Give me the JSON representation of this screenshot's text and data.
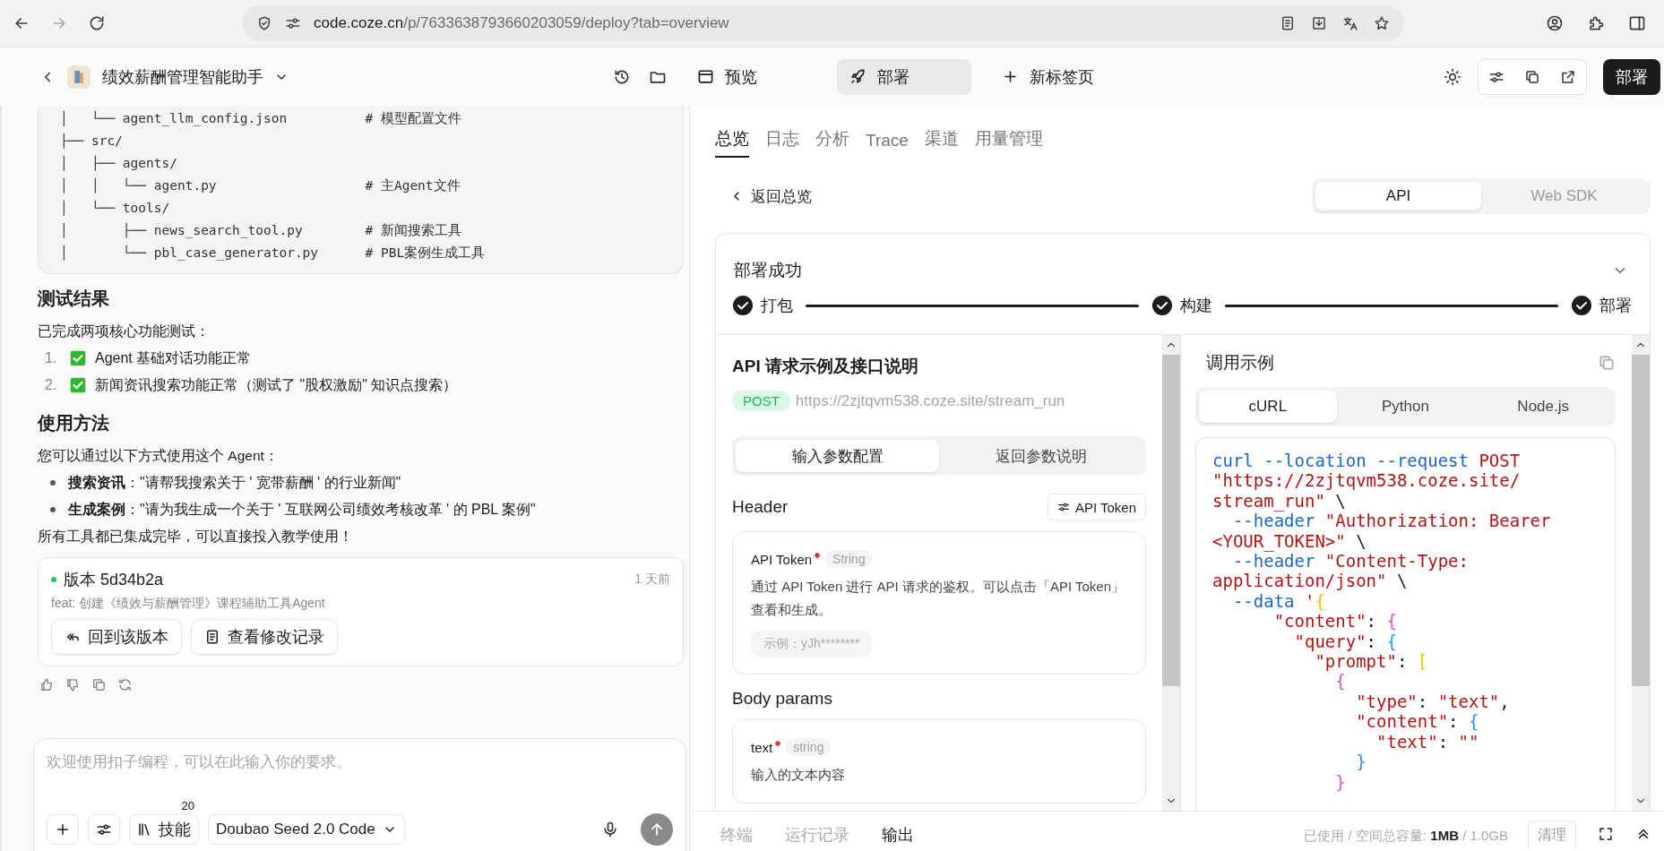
{
  "browser": {
    "url_host": "code.coze.cn",
    "url_path": "/p/7633638793660203059/deploy?tab=overview"
  },
  "app_header": {
    "project_title": "绩效薪酬管理智能助手",
    "tabs": [
      {
        "label": "预览",
        "selected": false
      },
      {
        "label": "部署",
        "selected": true
      },
      {
        "label": "新标签页",
        "selected": false
      }
    ],
    "deploy_button": "部署"
  },
  "chat": {
    "file_tree": [
      "│   └── agent_llm_config.json          # 模型配置文件",
      "├── src/",
      "│   ├── agents/",
      "│   │   └── agent.py                   # 主Agent文件",
      "│   └── tools/",
      "│       ├── news_search_tool.py        # 新闻搜索工具",
      "│       └── pbl_case_generator.py      # PBL案例生成工具"
    ],
    "test_heading": "测试结果",
    "test_intro": "已完成两项核心功能测试：",
    "test_items": [
      {
        "number": "1.",
        "text": "Agent 基础对话功能正常",
        "checked": true
      },
      {
        "number": "2.",
        "text": "新闻资讯搜索功能正常（测试了 \"股权激励\" 知识点搜索）",
        "checked": true
      }
    ],
    "usage_heading": "使用方法",
    "usage_intro": "您可以通过以下方式使用这个 Agent：",
    "usage_items": [
      "**搜索资讯**：\"请帮我搜索关于 ' 宽带薪酬 ' 的行业新闻\"",
      "**生成案例**：\"请为我生成一个关于 ' 互联网公司绩效考核改革 ' 的 PBL 案例\""
    ],
    "closing": "所有工具都已集成完毕，可以直接投入教学使用！",
    "version": {
      "title": "版本 5d34b2a",
      "time": "1 天前",
      "message": "feat: 创建《绩效与薪酬管理》课程辅助工具Agent",
      "buttons": [
        "回到该版本",
        "查看修改记录"
      ]
    }
  },
  "composer": {
    "placeholder": "欢迎使用扣子编程，可以在此输入你的要求。",
    "skills_label": "技能",
    "skills_count": "20",
    "model": "Doubao Seed 2.0 Code"
  },
  "deploy": {
    "tabs": [
      {
        "label": "总览",
        "selected": true
      },
      {
        "label": "日志",
        "selected": false
      },
      {
        "label": "分析",
        "selected": false
      },
      {
        "label": "Trace",
        "selected": false
      },
      {
        "label": "渠道",
        "selected": false
      },
      {
        "label": "用量管理",
        "selected": false
      }
    ],
    "back_link": "返回总览",
    "mode_tabs": [
      {
        "label": "API",
        "selected": true
      },
      {
        "label": "Web SDK",
        "selected": false
      }
    ],
    "status": "部署成功",
    "steps": [
      {
        "label": "打包",
        "done": true
      },
      {
        "label": "构建",
        "done": true
      },
      {
        "label": "部署",
        "done": true
      }
    ],
    "api": {
      "title": "API 请求示例及接口说明",
      "method": "POST",
      "endpoint": "https://2zjtqvm538.coze.site/stream_run",
      "param_tabs": [
        {
          "label": "输入参数配置",
          "selected": true
        },
        {
          "label": "返回参数说明",
          "selected": false
        }
      ],
      "header_label": "Header",
      "token_button": "API Token",
      "header_param": {
        "name": "API Token",
        "required": true,
        "type": "String",
        "description": "通过 API Token 进行 API 请求的鉴权。可以点击「API Token」查看和生成。",
        "example": "示例：yJh********"
      },
      "body_label": "Body params",
      "body_param": {
        "name": "text",
        "required": true,
        "type": "string",
        "description": "输入的文本内容"
      }
    },
    "example": {
      "title": "调用示例",
      "lang_tabs": [
        {
          "label": "cURL",
          "selected": true
        },
        {
          "label": "Python",
          "selected": false
        },
        {
          "label": "Node.js",
          "selected": false
        }
      ],
      "code_lines": [
        [
          {
            "kind": "cmd",
            "text": "curl --location --request "
          },
          {
            "kind": "str",
            "text": "POST"
          }
        ],
        [
          {
            "kind": "str",
            "text": "\"https://2zjtqvm538.coze.site/"
          }
        ],
        [
          {
            "kind": "str",
            "text": "stream_run\""
          },
          {
            "kind": "punct",
            "text": " \\"
          }
        ],
        [
          {
            "kind": "cmd",
            "text": "  --header "
          },
          {
            "kind": "str",
            "text": "\"Authorization: Bearer"
          }
        ],
        [
          {
            "kind": "str",
            "text": "<YOUR_TOKEN>\""
          },
          {
            "kind": "punct",
            "text": " \\"
          }
        ],
        [
          {
            "kind": "cmd",
            "text": "  --header "
          },
          {
            "kind": "str",
            "text": "\"Content-Type:"
          }
        ],
        [
          {
            "kind": "str",
            "text": "application/json\""
          },
          {
            "kind": "punct",
            "text": " \\"
          }
        ],
        [
          {
            "kind": "cmd",
            "text": "  --data "
          },
          {
            "kind": "str",
            "text": "'"
          },
          {
            "kind": "gold",
            "text": "{"
          }
        ],
        [
          {
            "kind": "str",
            "text": "      \"content\""
          },
          {
            "kind": "punct",
            "text": ": "
          },
          {
            "kind": "pink",
            "text": "{"
          }
        ],
        [
          {
            "kind": "str",
            "text": "        \"query\""
          },
          {
            "kind": "punct",
            "text": ": "
          },
          {
            "kind": "blue",
            "text": "{"
          }
        ],
        [
          {
            "kind": "str",
            "text": "          \"prompt\""
          },
          {
            "kind": "punct",
            "text": ": "
          },
          {
            "kind": "gold",
            "text": "["
          }
        ],
        [
          {
            "kind": "pink",
            "text": "            {"
          }
        ],
        [
          {
            "kind": "str",
            "text": "              \"type\""
          },
          {
            "kind": "punct",
            "text": ": "
          },
          {
            "kind": "str",
            "text": "\"text\""
          },
          {
            "kind": "punct",
            "text": ","
          }
        ],
        [
          {
            "kind": "str",
            "text": "              \"content\""
          },
          {
            "kind": "punct",
            "text": ": "
          },
          {
            "kind": "blue",
            "text": "{"
          }
        ],
        [
          {
            "kind": "str",
            "text": "                \"text\""
          },
          {
            "kind": "punct",
            "text": ": "
          },
          {
            "kind": "str",
            "text": "\"\""
          }
        ],
        [
          {
            "kind": "blue",
            "text": "              }"
          }
        ],
        [
          {
            "kind": "pink",
            "text": "            }"
          }
        ]
      ]
    }
  },
  "bottom_bar": {
    "tabs": [
      {
        "label": "终端",
        "selected": false
      },
      {
        "label": "运行记录",
        "selected": false
      },
      {
        "label": "输出",
        "selected": true
      }
    ],
    "storage": "已使用 / 空间总容量: **1MB** / 1.0GB",
    "clear_button": "清理"
  }
}
